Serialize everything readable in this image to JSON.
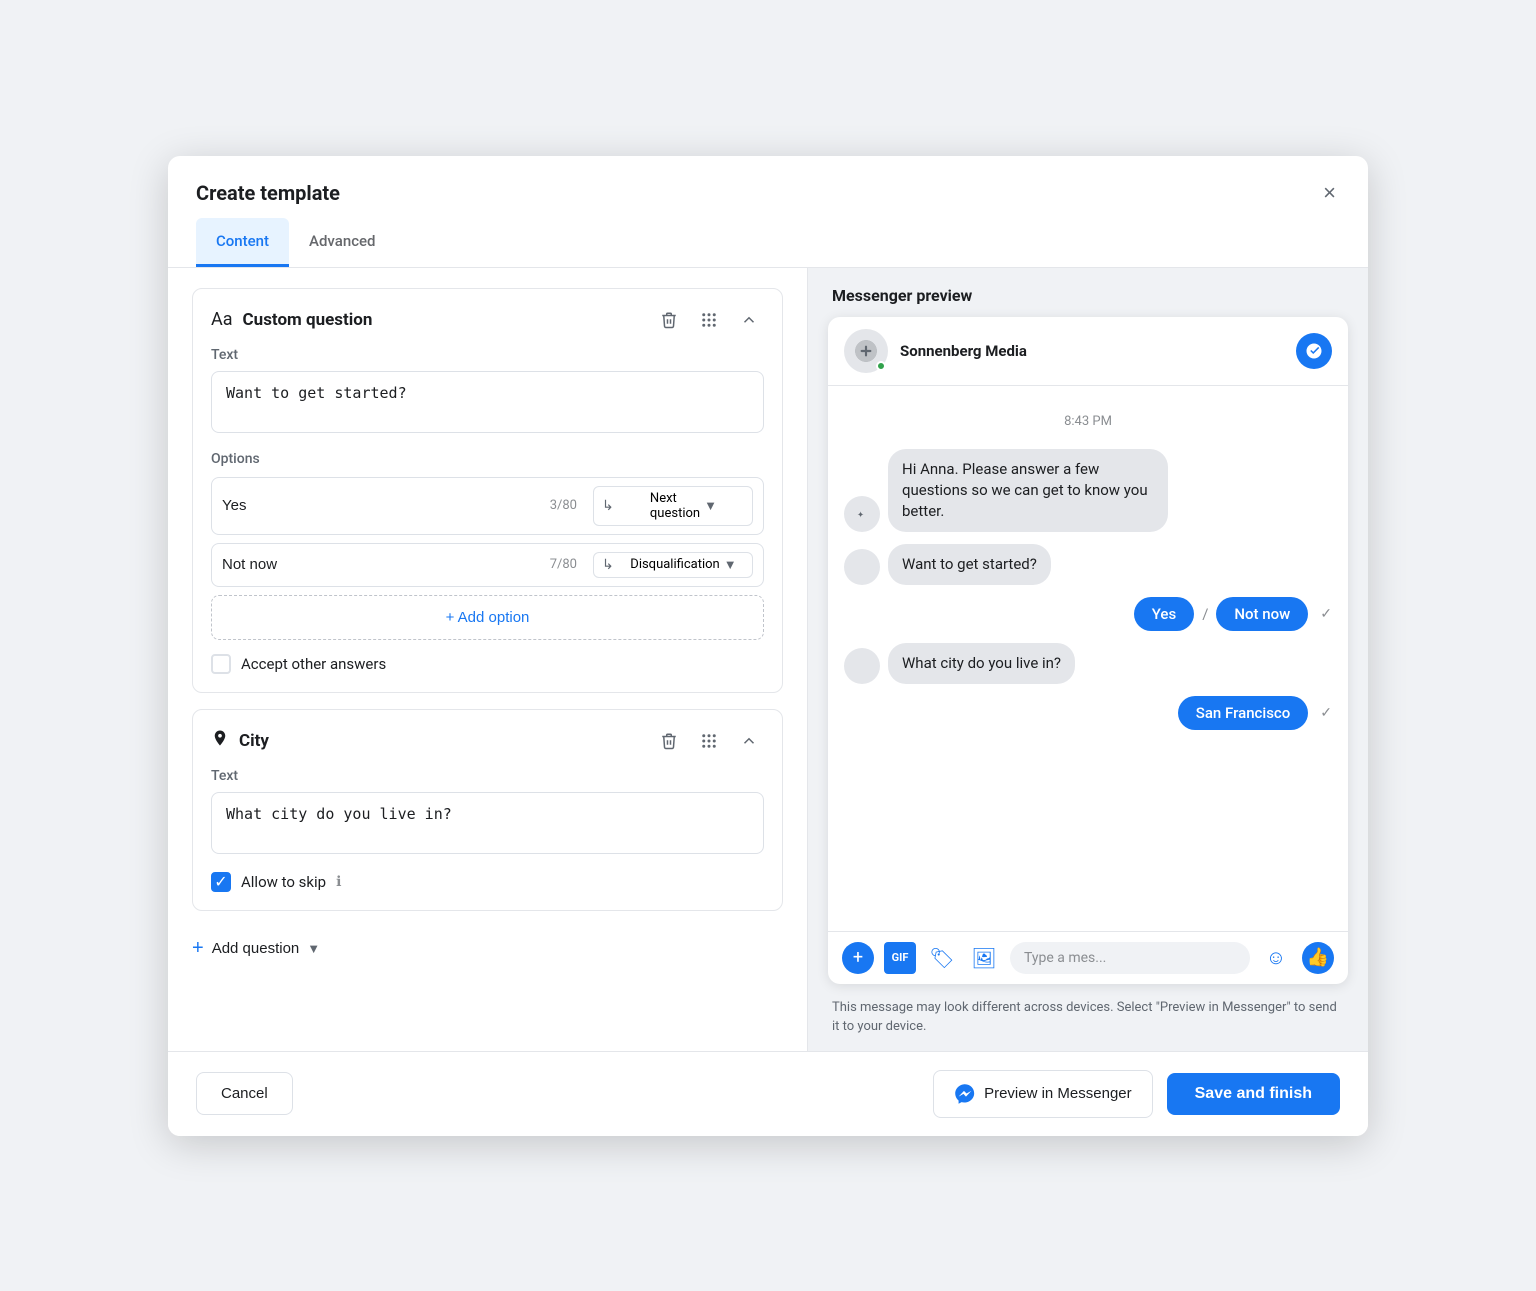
{
  "modal": {
    "title": "Create template",
    "close_label": "×"
  },
  "tabs": {
    "content_label": "Content",
    "advanced_label": "Advanced"
  },
  "custom_question_card": {
    "icon": "Aa",
    "title": "Custom question",
    "text_label": "Text",
    "text_value": "Want to get started?",
    "options_label": "Options",
    "options": [
      {
        "value": "Yes",
        "count": "3/80",
        "goto": "Next question"
      },
      {
        "value": "Not now",
        "count": "7/80",
        "goto": "Disqualification"
      }
    ],
    "add_option_label": "+ Add option",
    "accept_other_label": "Accept other answers"
  },
  "city_card": {
    "icon": "📍",
    "title": "City",
    "text_label": "Text",
    "text_value": "What city do you live in?",
    "allow_skip_label": "Allow to skip"
  },
  "add_question": {
    "label": "Add question"
  },
  "preview": {
    "title": "Messenger preview",
    "company_name": "Sonnenberg Media",
    "time": "8:43 PM",
    "bot_intro": "Hi Anna. Please answer a few questions so we can get to know you better.",
    "question1": "Want to get started?",
    "reply_yes": "Yes",
    "reply_not_now": "Not now",
    "question2": "What city do you live in?",
    "reply_sf": "San Francisco",
    "input_placeholder": "Type a mes...",
    "disclaimer": "This message may look different across devices. Select \"Preview in Messenger\" to send it to your device."
  },
  "footer": {
    "cancel_label": "Cancel",
    "preview_label": "Preview in Messenger",
    "save_label": "Save and finish"
  }
}
